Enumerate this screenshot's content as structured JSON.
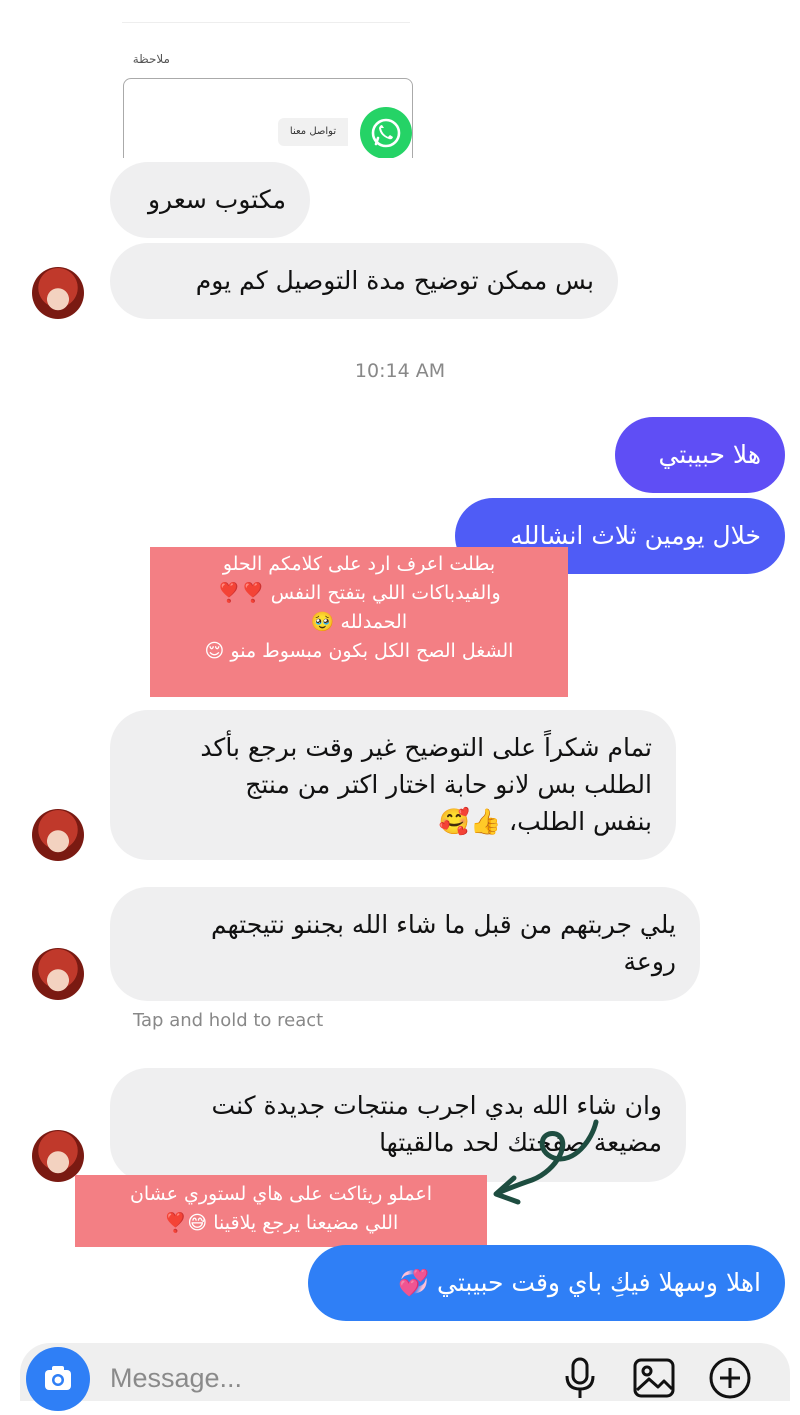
{
  "shared_card": {
    "note_label": "ملاحظة",
    "whatsapp_label": "تواصل معنا"
  },
  "messages": [
    {
      "text": "مكتوب سعرو"
    },
    {
      "text": "بس ممكن توضيح مدة التوصيل كم يوم"
    }
  ],
  "timestamp": "10:14 AM",
  "sent": [
    {
      "text": "هلا حبيبتي"
    },
    {
      "text": "خلال يومين ثلاث انشالله"
    }
  ],
  "story_overlay_1": {
    "lines": [
      "بطلت اعرف ارد على كلامكم الحلو",
      "والفيدباكات اللي بتفتح النفس ❣️❣️",
      "الحمدلله 🥹",
      "الشغل الصح الكل بكون مبسوط منو 😌"
    ]
  },
  "incoming_2": [
    {
      "lines": [
        "تمام شكراً على التوضيح غير وقت برجع بأكد",
        "الطلب بس لانو حابة اختار اكتر من منتج",
        "بنفس الطلب، 👍🥰"
      ]
    },
    {
      "lines": [
        "يلي جربتهم من قبل ما شاء الله بجننو نتيجتهم",
        "روعة"
      ]
    },
    {
      "lines": [
        "وان شاء الله بدي اجرب منتجات جديدة كنت",
        "مضيعة صفحتك لحد مالقيتها"
      ]
    }
  ],
  "react_hint": "Tap and hold to react",
  "story_overlay_2": {
    "lines": [
      "اعملو ريئاكت على هاي لستوري عشان",
      "اللي مضيعنا يرجع يلاقينا 😅❣️"
    ]
  },
  "final_sent": {
    "text": "اهلا وسهلا فيكِ باي وقت حبيبتي 💞"
  },
  "composer": {
    "placeholder": "Message..."
  },
  "colors": {
    "incoming_bubble": "#efeff0",
    "outgoing_purple": "#5f4ef5",
    "outgoing_blue": "#2f7ff6",
    "overlay_pink": "#f37f84",
    "whatsapp_green": "#25D366"
  },
  "icons": [
    "whatsapp-icon",
    "camera-icon",
    "microphone-icon",
    "gallery-icon",
    "add-icon",
    "curved-arrow-icon"
  ]
}
